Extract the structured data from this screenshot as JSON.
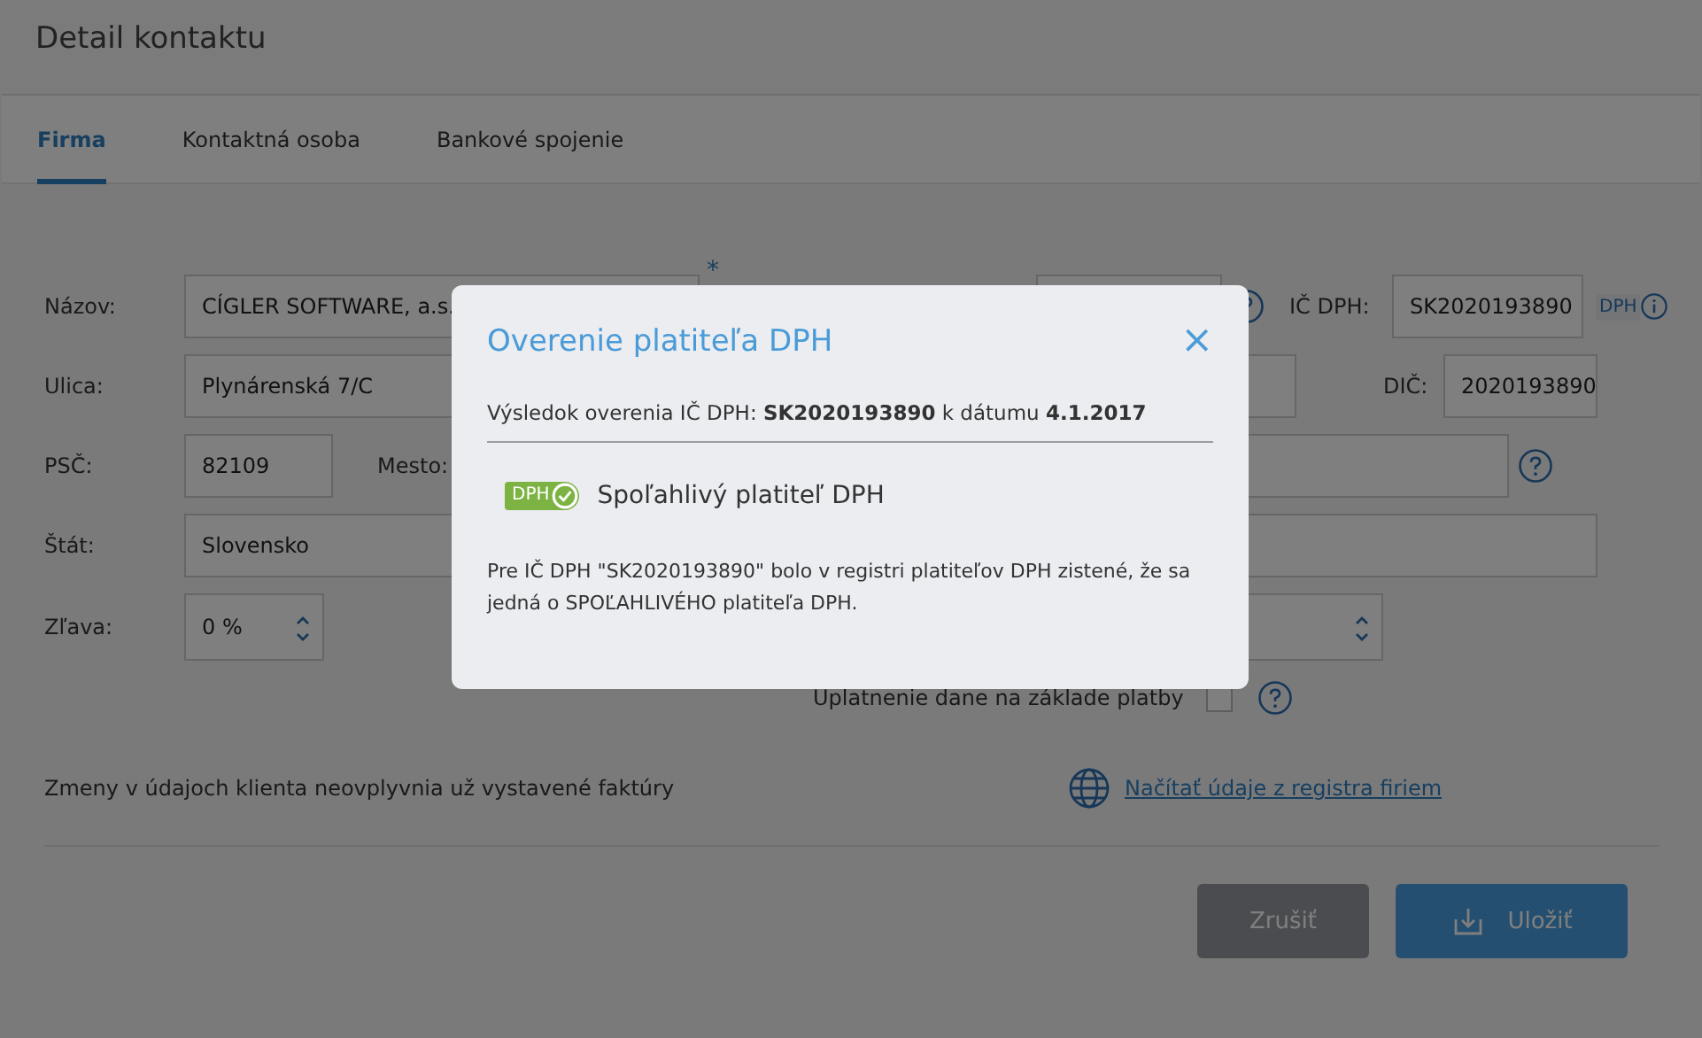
{
  "header": {
    "title": "Detail kontaktu"
  },
  "tabs": [
    {
      "label": "Firma",
      "selected": true
    },
    {
      "label": "Kontaktná osoba",
      "selected": false
    },
    {
      "label": "Bankové spojenie",
      "selected": false
    }
  ],
  "form": {
    "name": {
      "label": "Názov:",
      "value": "CÍGLER SOFTWARE, a.s.",
      "required_mark": "*"
    },
    "vat_id": {
      "label": "IČ DPH:",
      "value": "SK2020193890",
      "badge": "DPH"
    },
    "street": {
      "label": "Ulica:",
      "value": "Plynárenská 7/C"
    },
    "tax_id": {
      "label": "DIČ:",
      "value": "2020193890"
    },
    "zip": {
      "label": "PSČ:",
      "value": "82109"
    },
    "city": {
      "label": "Mesto:"
    },
    "country": {
      "label": "Štát:",
      "value": "Slovensko"
    },
    "discount": {
      "label": "Zľava:",
      "value": "0 %"
    },
    "cash_accounting": {
      "label": "Uplatnenie dane na základe platby",
      "checked": false
    }
  },
  "note": "Zmeny v údajoch klienta neovplyvnia už vystavené faktúry",
  "registry_link": "Načítať údaje z registra firiem",
  "buttons": {
    "cancel": "Zrušiť",
    "save": "Uložiť"
  },
  "modal": {
    "title": "Overenie platiteľa DPH",
    "close": "×",
    "result": "Výsledok overenia IČ DPH: **SK2020193890** k dátumu **4.1.2017**",
    "badge": "DPH",
    "status": "Spoľahlivý platiteľ DPH",
    "message": "Pre IČ DPH \"SK2020193890\" bolo v registri platiteľov DPH zistené, že sa jedná o SPOĽAHLIVÉHO platiteľa DPH."
  }
}
